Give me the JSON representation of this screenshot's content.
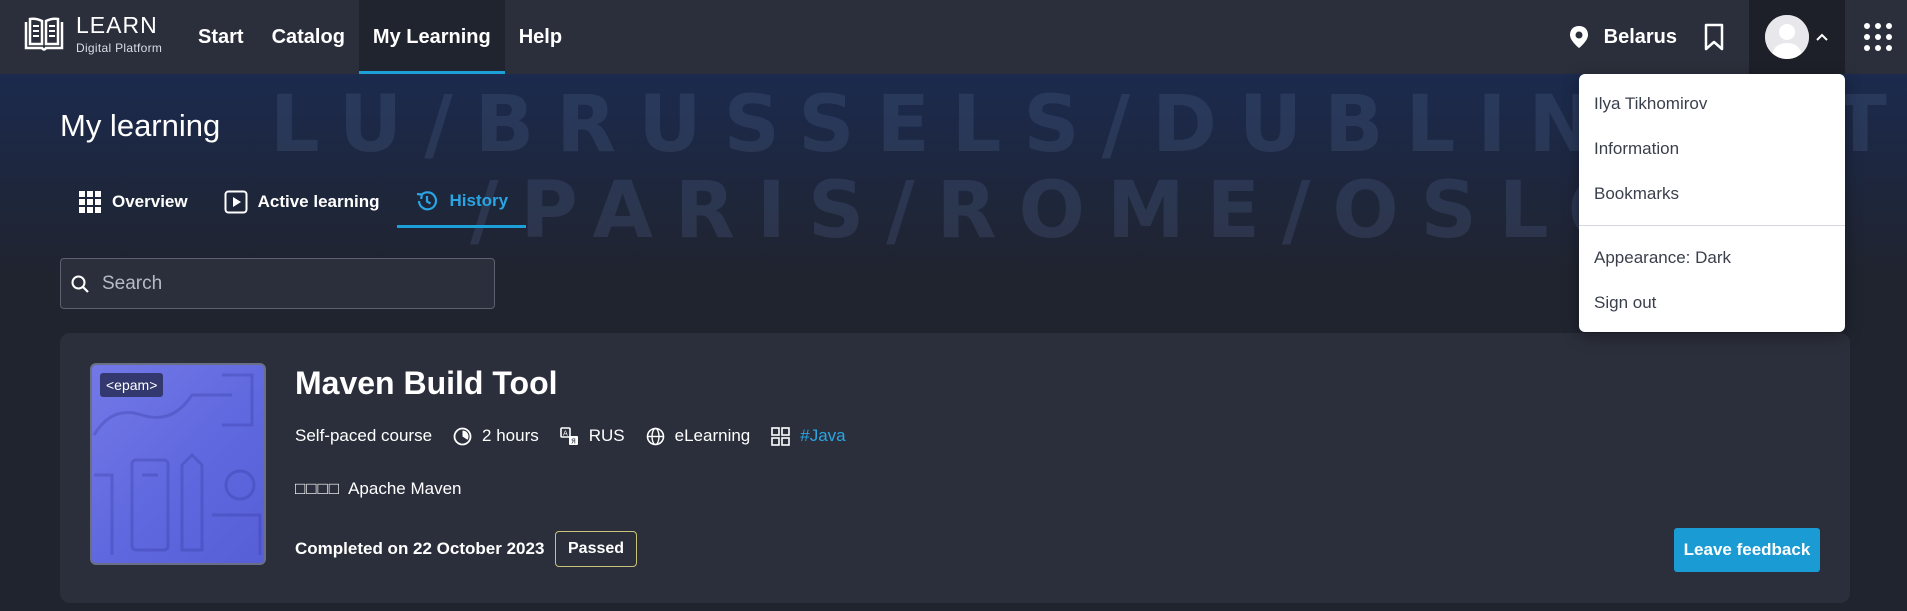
{
  "brand": {
    "title": "LEARN",
    "subtitle": "Digital Platform"
  },
  "nav": {
    "items": [
      "Start",
      "Catalog",
      "My Learning",
      "Help"
    ],
    "active": "My Learning"
  },
  "header_right": {
    "location": "Belarus"
  },
  "page": {
    "title": "My learning"
  },
  "tabs": [
    {
      "label": "Overview",
      "icon": "grid-icon"
    },
    {
      "label": "Active learning",
      "icon": "play-icon"
    },
    {
      "label": "History",
      "icon": "history-icon",
      "active": true
    }
  ],
  "search": {
    "placeholder": "Search",
    "value": ""
  },
  "course": {
    "badge_logo": "<epam>",
    "title": "Maven Build Tool",
    "type": "Self-paced course",
    "duration": "2 hours",
    "language": "RUS",
    "format": "eLearning",
    "tag": "#Java",
    "skill_prefix": "□□□□",
    "skill": "Apache Maven",
    "completed": "Completed on 22 October 2023",
    "status": "Passed",
    "feedback_label": "Leave feedback"
  },
  "user_menu": {
    "name": "Ilya Tikhomirov",
    "items": [
      "Information",
      "Bookmarks"
    ],
    "appearance": "Appearance: Dark",
    "sign_out": "Sign out"
  },
  "background_text": {
    "line1": "LU/BRUSSELS/DUBLIN/POTSD",
    "line2": "/PARIS/ROME/OSLO/"
  },
  "colors": {
    "accent": "#1d9fd8",
    "background": "#20242f",
    "surface": "#2b2f3b",
    "passed_border": "#c9c27a"
  }
}
